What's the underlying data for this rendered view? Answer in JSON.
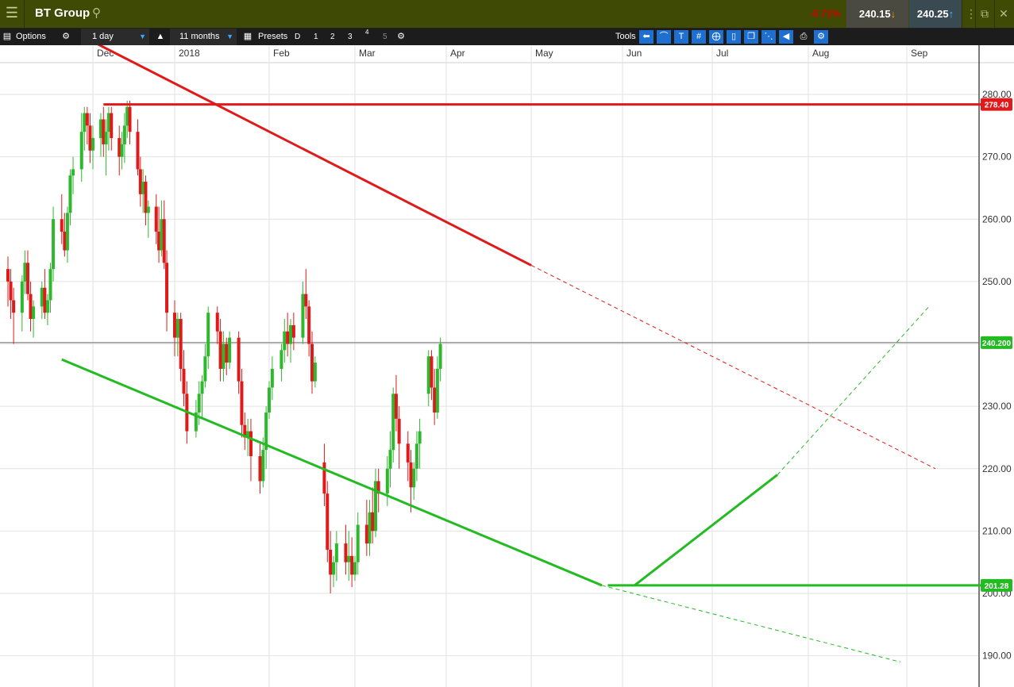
{
  "header": {
    "instrument": "BT Group",
    "change": "-0.71%",
    "bid": "240.15",
    "ask": "240.25"
  },
  "toolbar": {
    "options_label": "Options",
    "interval": "1 day",
    "range": "11 months",
    "presets_label": "Presets",
    "preset_buttons": [
      "D",
      "1",
      "2",
      "3",
      "4",
      "5"
    ],
    "tools_label": "Tools"
  },
  "colors": {
    "up": "#2db82d",
    "down": "#e01a1a",
    "resistance": "#e01a1a",
    "support": "#22bb22",
    "grid": "#e2e2e2"
  },
  "chart_data": {
    "type": "candlestick",
    "x_axis_labels": [
      "Dec",
      "2018",
      "Feb",
      "Mar",
      "Apr",
      "May",
      "Jun",
      "Jul",
      "Aug",
      "Sep"
    ],
    "y_axis_ticks": [
      190,
      200,
      210,
      220,
      230,
      240,
      250,
      260,
      270,
      280
    ],
    "ylim": [
      189,
      286
    ],
    "price_tags": [
      {
        "label": "278.40",
        "value": 278.4,
        "color": "#e01a1a"
      },
      {
        "label": "240.200",
        "value": 240.2,
        "color": "#22bb22"
      },
      {
        "label": "201.28",
        "value": 201.28,
        "color": "#22bb22"
      }
    ],
    "current_price": 240.2,
    "trendlines": [
      {
        "name": "resistance-horizontal",
        "color": "#e01a1a",
        "style": "solid",
        "from": [
          "2017-12-05",
          278.4
        ],
        "to": [
          "2018-09-30",
          278.4
        ]
      },
      {
        "name": "resistance-descending",
        "color": "#e01a1a",
        "style": "solid",
        "from": [
          "2017-11-20",
          291.0
        ],
        "to": [
          "2018-05-01",
          252.6
        ]
      },
      {
        "name": "resistance-descending-extension",
        "color": "#e01a1a",
        "style": "dashed",
        "from": [
          "2018-05-01",
          252.6
        ],
        "to": [
          "2018-09-10",
          220.0
        ]
      },
      {
        "name": "support-descending",
        "color": "#22bb22",
        "style": "solid",
        "from": [
          "2017-11-20",
          237.5
        ],
        "to": [
          "2018-05-25",
          201.28
        ]
      },
      {
        "name": "support-descending-extension",
        "color": "#22bb22",
        "style": "dashed",
        "from": [
          "2018-05-25",
          201.28
        ],
        "to": [
          "2018-08-30",
          189.0
        ]
      },
      {
        "name": "support-horizontal",
        "color": "#22bb22",
        "style": "solid",
        "from": [
          "2018-05-27",
          201.28
        ],
        "to": [
          "2018-09-30",
          201.28
        ]
      },
      {
        "name": "support-ascending",
        "color": "#22bb22",
        "style": "solid",
        "from": [
          "2018-06-05",
          201.28
        ],
        "to": [
          "2018-07-22",
          219.0
        ]
      },
      {
        "name": "support-ascending-extension",
        "color": "#22bb22",
        "style": "dashed",
        "from": [
          "2018-07-22",
          219.0
        ],
        "to": [
          "2018-09-08",
          246.0
        ]
      }
    ],
    "candles": [
      [
        252,
        254,
        246,
        250
      ],
      [
        250,
        252,
        244,
        247
      ],
      [
        247,
        249,
        240,
        245
      ],
      [
        245,
        251,
        242,
        250
      ],
      [
        250,
        255,
        248,
        253
      ],
      [
        253,
        255,
        247,
        248
      ],
      [
        248,
        250,
        242,
        244
      ],
      [
        244,
        247,
        241,
        246
      ],
      [
        246,
        250,
        244,
        249
      ],
      [
        249,
        252,
        244,
        245
      ],
      [
        245,
        248,
        243,
        247
      ],
      [
        247,
        253,
        245,
        252
      ],
      [
        252,
        262,
        250,
        260
      ],
      [
        260,
        264,
        256,
        258
      ],
      [
        258,
        261,
        254,
        255
      ],
      [
        255,
        262,
        253,
        261
      ],
      [
        261,
        268,
        259,
        267
      ],
      [
        267,
        270,
        264,
        268
      ],
      [
        268,
        277,
        266,
        274
      ],
      [
        274,
        278,
        271,
        277
      ],
      [
        277,
        278,
        272,
        275
      ],
      [
        275,
        277,
        269,
        271
      ],
      [
        271,
        275,
        268,
        273
      ],
      [
        273,
        277,
        270,
        276
      ],
      [
        276,
        278,
        270,
        272
      ],
      [
        272,
        276,
        267,
        274
      ],
      [
        274,
        278,
        271,
        277
      ],
      [
        277,
        278,
        271,
        273
      ],
      [
        273,
        275,
        267,
        270
      ],
      [
        270,
        274,
        268,
        272
      ],
      [
        272,
        277,
        269,
        275
      ],
      [
        275,
        279,
        273,
        278
      ],
      [
        278,
        279,
        272,
        274
      ],
      [
        274,
        276,
        267,
        268
      ],
      [
        268,
        270,
        262,
        264
      ],
      [
        264,
        268,
        261,
        266
      ],
      [
        266,
        267,
        259,
        261
      ],
      [
        261,
        263,
        257,
        262
      ],
      [
        262,
        264,
        256,
        258
      ],
      [
        258,
        262,
        253,
        255
      ],
      [
        255,
        263,
        254,
        260
      ],
      [
        260,
        263,
        252,
        253
      ],
      [
        253,
        255,
        242,
        245
      ],
      [
        245,
        247,
        238,
        241
      ],
      [
        241,
        245,
        238,
        244
      ],
      [
        244,
        245,
        234,
        236
      ],
      [
        236,
        239,
        230,
        232
      ],
      [
        232,
        234,
        224,
        226
      ],
      [
        226,
        231,
        225,
        229
      ],
      [
        229,
        234,
        227,
        232
      ],
      [
        232,
        235,
        228,
        234
      ],
      [
        234,
        240,
        233,
        238
      ],
      [
        238,
        246,
        236,
        245
      ],
      [
        245,
        246,
        240,
        242
      ],
      [
        242,
        244,
        234,
        236
      ],
      [
        236,
        242,
        234,
        240
      ],
      [
        240,
        241,
        235,
        237
      ],
      [
        237,
        242,
        236,
        241
      ],
      [
        241,
        242,
        232,
        234
      ],
      [
        234,
        236,
        225,
        227
      ],
      [
        227,
        229,
        223,
        225
      ],
      [
        225,
        228,
        222,
        226
      ],
      [
        226,
        228,
        218,
        222
      ],
      [
        222,
        224,
        216,
        218
      ],
      [
        218,
        225,
        217,
        223
      ],
      [
        223,
        230,
        220,
        229
      ],
      [
        229,
        234,
        228,
        233
      ],
      [
        233,
        238,
        231,
        236
      ],
      [
        236,
        240,
        234,
        239
      ],
      [
        239,
        244,
        237,
        242
      ],
      [
        242,
        245,
        238,
        240
      ],
      [
        240,
        244,
        237,
        243
      ],
      [
        243,
        245,
        239,
        241
      ],
      [
        241,
        250,
        240,
        248
      ],
      [
        248,
        252,
        244,
        246
      ],
      [
        246,
        247,
        238,
        240
      ],
      [
        240,
        242,
        232,
        234
      ],
      [
        234,
        238,
        233,
        237
      ],
      [
        221,
        224,
        214,
        216
      ],
      [
        216,
        218,
        205,
        207
      ],
      [
        207,
        210,
        200,
        203
      ],
      [
        203,
        206,
        201,
        205
      ],
      [
        205,
        210,
        202,
        208
      ],
      [
        208,
        211,
        203,
        205
      ],
      [
        205,
        210,
        202,
        206
      ],
      [
        206,
        209,
        201,
        203
      ],
      [
        203,
        206,
        202,
        205
      ],
      [
        205,
        213,
        203,
        211
      ],
      [
        211,
        215,
        206,
        208
      ],
      [
        208,
        215,
        206,
        213
      ],
      [
        213,
        217,
        208,
        210
      ],
      [
        210,
        220,
        209,
        218
      ],
      [
        218,
        220,
        213,
        216
      ],
      [
        216,
        222,
        214,
        220
      ],
      [
        220,
        226,
        217,
        223
      ],
      [
        223,
        233,
        221,
        232
      ],
      [
        232,
        235,
        226,
        228
      ],
      [
        228,
        230,
        220,
        224
      ],
      [
        224,
        226,
        218,
        221
      ],
      [
        221,
        223,
        213,
        217
      ],
      [
        217,
        221,
        215,
        220
      ],
      [
        220,
        226,
        218,
        224
      ],
      [
        224,
        228,
        220,
        226
      ],
      [
        232,
        239,
        230,
        238
      ],
      [
        238,
        239,
        231,
        233
      ],
      [
        233,
        236,
        227,
        229
      ],
      [
        229,
        238,
        228,
        236
      ],
      [
        236,
        241,
        234,
        240
      ]
    ]
  }
}
